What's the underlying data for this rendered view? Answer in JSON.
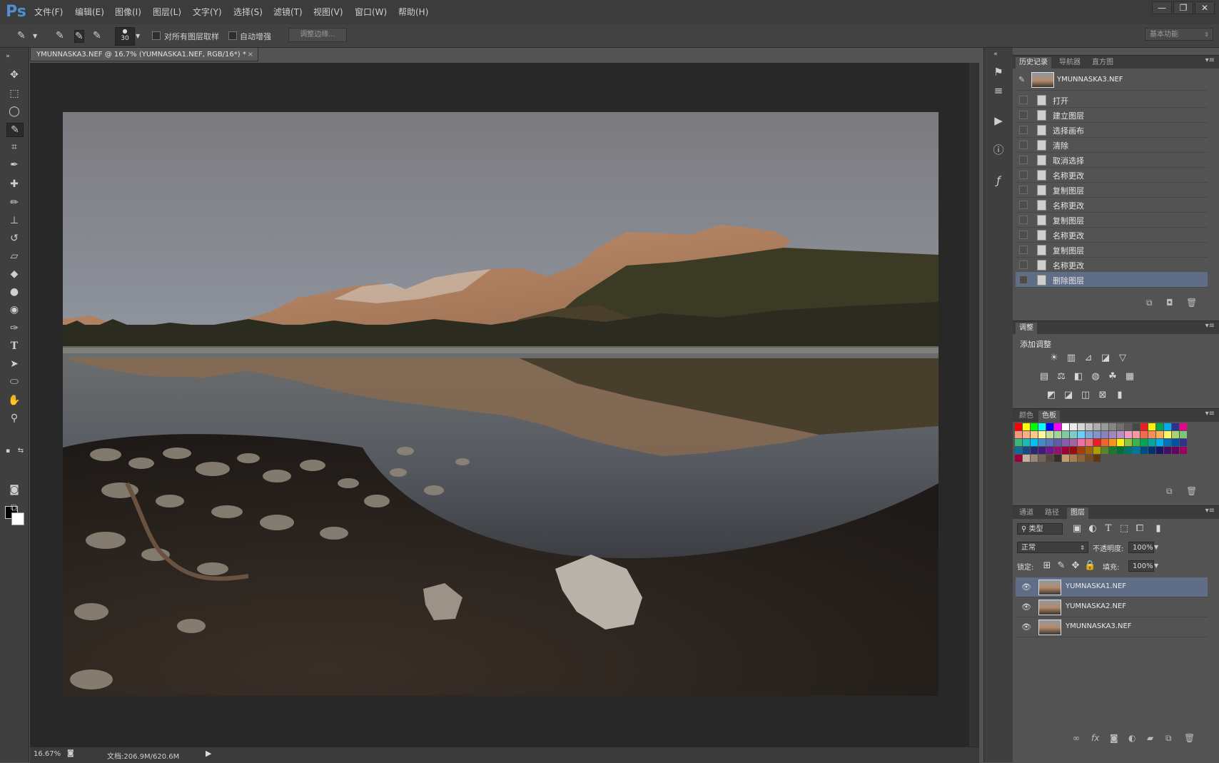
{
  "app": {
    "logo": "Ps",
    "menu": [
      "文件(F)",
      "编辑(E)",
      "图像(I)",
      "图层(L)",
      "文字(Y)",
      "选择(S)",
      "滤镜(T)",
      "视图(V)",
      "窗口(W)",
      "帮助(H)"
    ],
    "window_controls": [
      "—",
      "❐",
      "✕"
    ]
  },
  "options": {
    "brush_size": "30",
    "sample_all_layers": "对所有图层取样",
    "auto_enhance": "自动增强",
    "refine_edge": "调整边缘...",
    "workspace": "基本功能"
  },
  "document": {
    "tab_title": "YMUNNASKA3.NEF @ 16.7% (YUMNASKA1.NEF, RGB/16*) *",
    "close": "×"
  },
  "status": {
    "zoom": "16.67%",
    "doc_size": "文档:206.9M/620.6M"
  },
  "history": {
    "tabs": [
      "历史记录",
      "导航器",
      "直方图"
    ],
    "snapshot": "YMUNNASKA3.NEF",
    "items": [
      "打开",
      "建立图层",
      "选择画布",
      "清除",
      "取消选择",
      "名称更改",
      "复制图层",
      "名称更改",
      "复制图层",
      "名称更改",
      "复制图层",
      "名称更改",
      "删除图层"
    ],
    "selected_index": 12
  },
  "adjustments": {
    "tab": "调整",
    "heading": "添加调整"
  },
  "swatches": {
    "tabs": [
      "颜色",
      "色板"
    ],
    "colors": [
      [
        "#ff0000",
        "#ffff00",
        "#00ff00",
        "#00ffff",
        "#0000ff",
        "#ff00ff",
        "#ffffff",
        "#ebebeb",
        "#d6d6d6",
        "#c2c2c2",
        "#adadad",
        "#999999",
        "#858585",
        "#707070",
        "#5c5c5c",
        "#474747",
        "#ee1d24",
        "#fff200",
        "#00a651",
        "#00aeef",
        "#2e3192",
        "#ec008c"
      ],
      [
        "#f7977a",
        "#f9ad81",
        "#fdc68a",
        "#fff79a",
        "#c4df9b",
        "#a3d39c",
        "#82ca9d",
        "#7bcdc8",
        "#6ecff6",
        "#7ea7d8",
        "#8493ca",
        "#8882be",
        "#a187be",
        "#bc8dbf",
        "#f49ac2",
        "#f6989d",
        "#f26c4f",
        "#f68e55",
        "#fbaf5c",
        "#fff467",
        "#acd372",
        "#7cc576"
      ],
      [
        "#3bb878",
        "#1abbb4",
        "#00bff3",
        "#438ccb",
        "#5574b9",
        "#605ca8",
        "#855fa8",
        "#a763a8",
        "#f06ea9",
        "#f26d7d",
        "#ed1c24",
        "#f26522",
        "#f7941d",
        "#fff200",
        "#8dc63f",
        "#39b54a",
        "#00a651",
        "#00a99d",
        "#00aeef",
        "#0072bc",
        "#0054a6",
        "#2e3192"
      ],
      [
        "#0c6e96",
        "#174a8c",
        "#2b286f",
        "#46177f",
        "#70178e",
        "#98106d",
        "#9e0039",
        "#9e0b0f",
        "#a0410d",
        "#a3620a",
        "#aba000",
        "#598527",
        "#197b30",
        "#007236",
        "#00746b",
        "#0076a3",
        "#004b80",
        "#003471",
        "#1b1464",
        "#440e62",
        "#630460",
        "#9e005d"
      ],
      [
        "#9e0039",
        "#c7b299",
        "#998675",
        "#736357",
        "#534741",
        "#37302a",
        "#c69c6e",
        "#a67c52",
        "#8c6239",
        "#754c24",
        "#603913"
      ]
    ]
  },
  "layers": {
    "tabs": [
      "通道",
      "路径",
      "图层"
    ],
    "filter": "类型",
    "blend_mode": "正常",
    "opacity_label": "不透明度:",
    "opacity": "100%",
    "lock_label": "锁定:",
    "fill_label": "填充:",
    "fill": "100%",
    "items": [
      {
        "name": "YUMNASKA1.NEF",
        "visible": true,
        "selected": true
      },
      {
        "name": "YUMNASKA2.NEF",
        "visible": true,
        "selected": false
      },
      {
        "name": "YMUNNASKA3.NEF",
        "visible": true,
        "selected": false
      }
    ]
  }
}
